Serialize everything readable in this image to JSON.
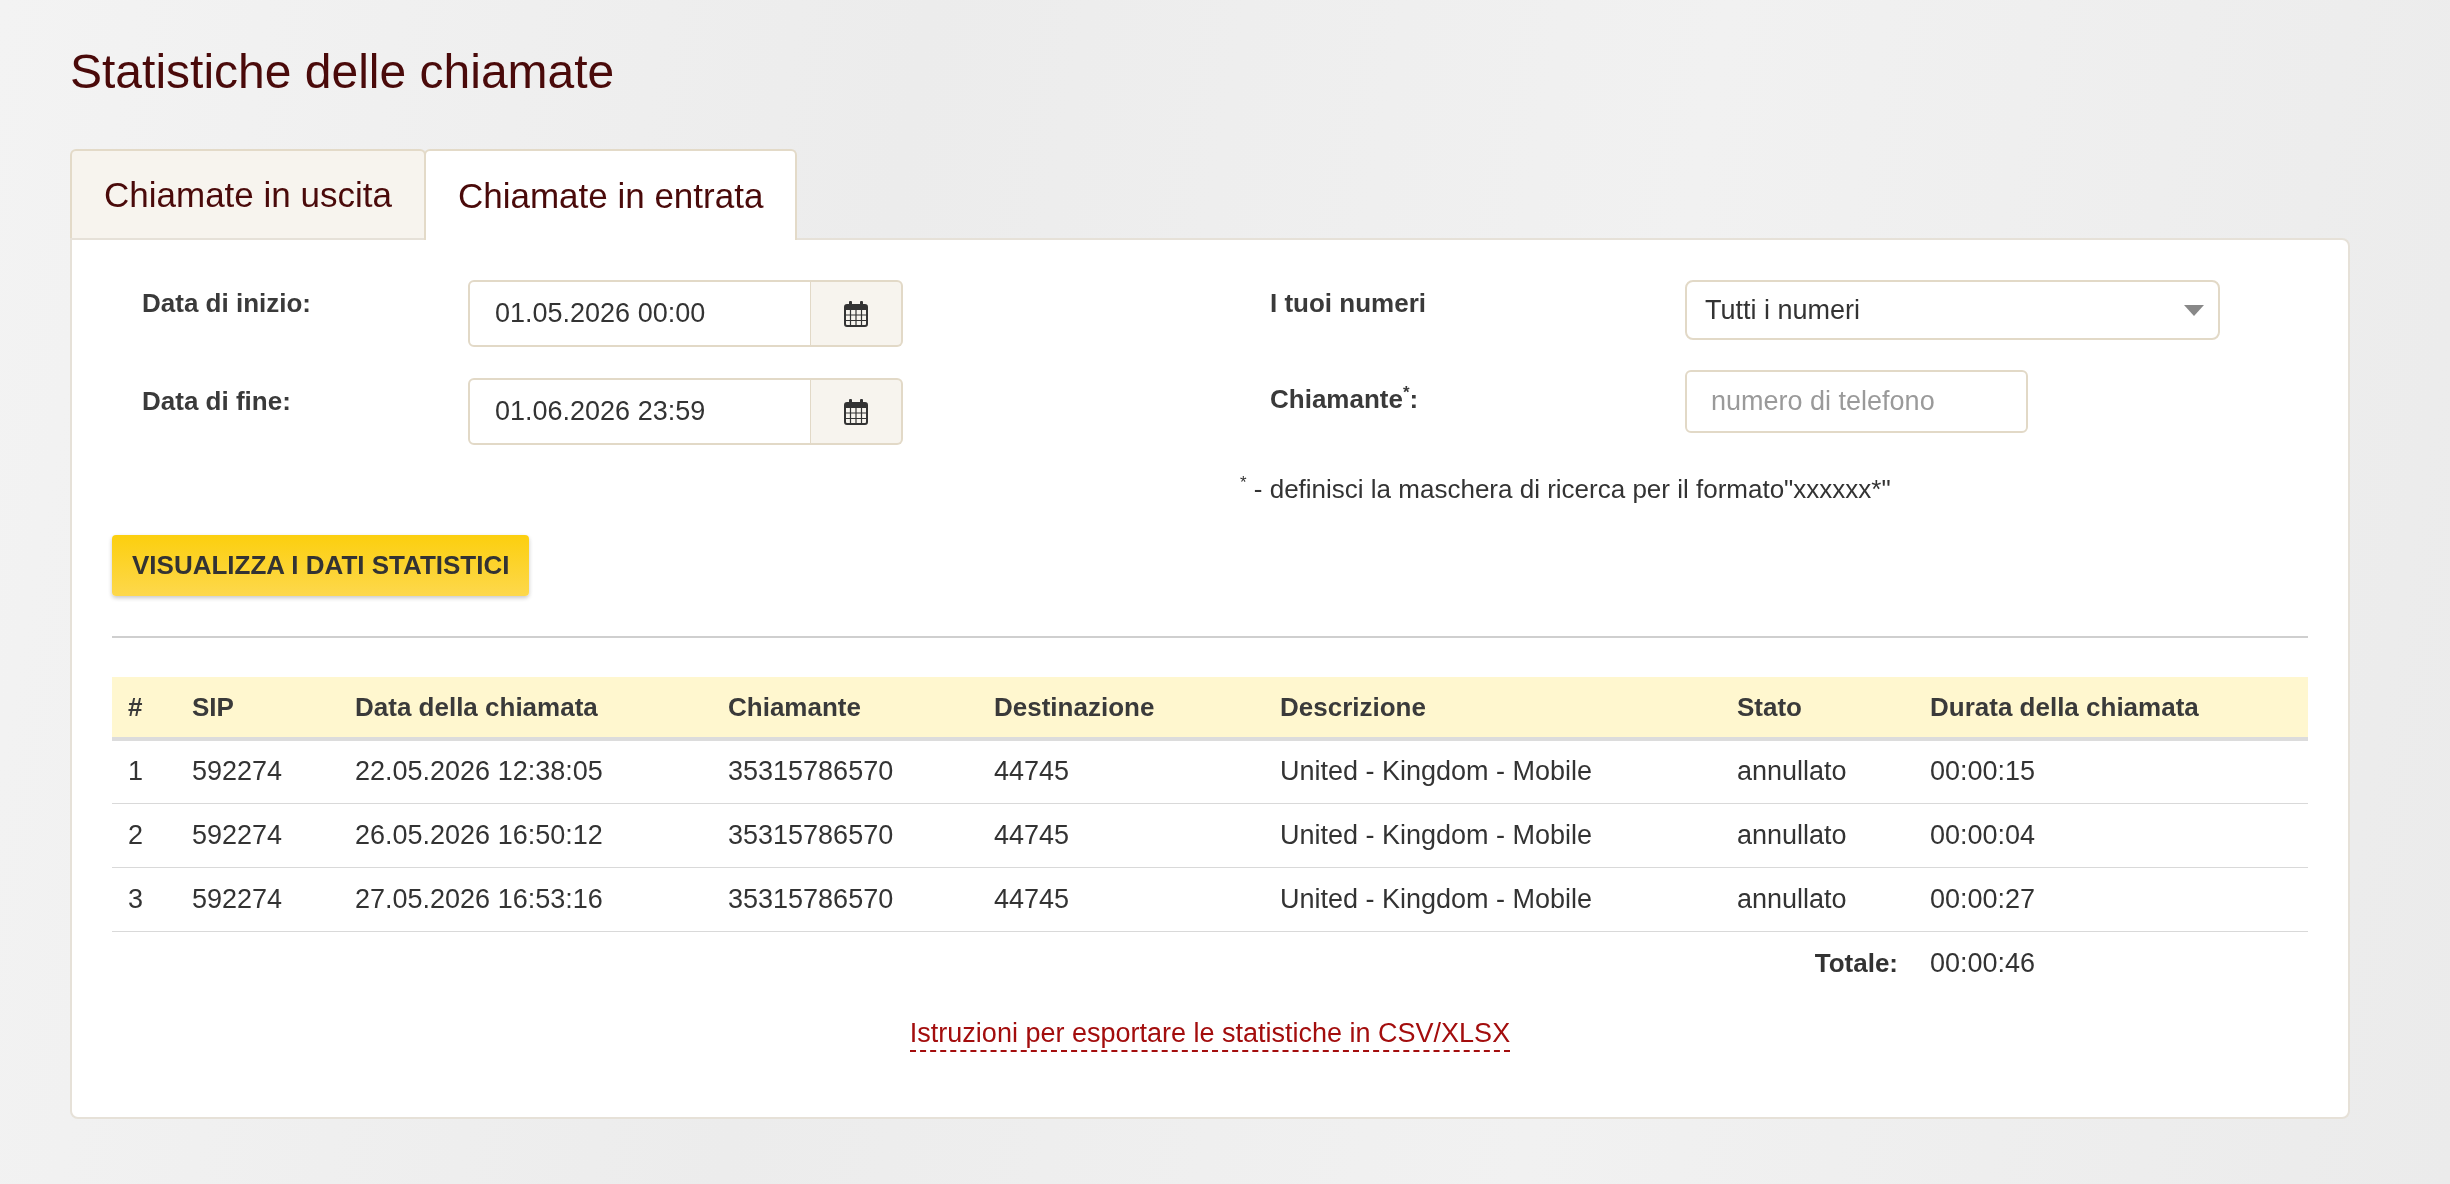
{
  "page": {
    "title": "Statistiche delle chiamate"
  },
  "tabs": [
    {
      "label": "Chiamate in uscita",
      "selected": false
    },
    {
      "label": "Chiamate in entrata",
      "selected": true
    }
  ],
  "filters": {
    "start_date": {
      "label": "Data di inizio:",
      "value": "01.05.2026 00:00"
    },
    "end_date": {
      "label": "Data di fine:",
      "value": "01.06.2026 23:59"
    },
    "numbers": {
      "label": "I tuoi numeri",
      "value": "Tutti i numeri"
    },
    "caller": {
      "label": "Chiamante$^{*}$:",
      "placeholder": "numero di telefono"
    },
    "note": "$^{*}$ - definisci la maschera di ricerca per il formato\"xxxxxx*\""
  },
  "show_button": {
    "label": "VISUALIZZA I DATI STATISTICI"
  },
  "table": {
    "columns": [
      "#",
      "SIP",
      "Data della chiamata",
      "Chiamante",
      "Destinazione",
      "Descrizione",
      "Stato",
      "Durata della chiamata"
    ],
    "rows": [
      [
        "1",
        "592274",
        "22.05.2026 12:38:05",
        "35315786570",
        "44745",
        "United - Kingdom - Mobile",
        "annullato",
        "00:00:15"
      ],
      [
        "2",
        "592274",
        "26.05.2026 16:50:12",
        "35315786570",
        "44745",
        "United - Kingdom - Mobile",
        "annullato",
        "00:00:04"
      ],
      [
        "3",
        "592274",
        "27.05.2026 16:53:16",
        "35315786570",
        "44745",
        "United - Kingdom - Mobile",
        "annullato",
        "00:00:27"
      ]
    ],
    "total": {
      "label": "Totale:",
      "value": "00:00:46"
    }
  },
  "export_link": "Istruzioni per esportare le statistiche in CSV/XLSX"
}
